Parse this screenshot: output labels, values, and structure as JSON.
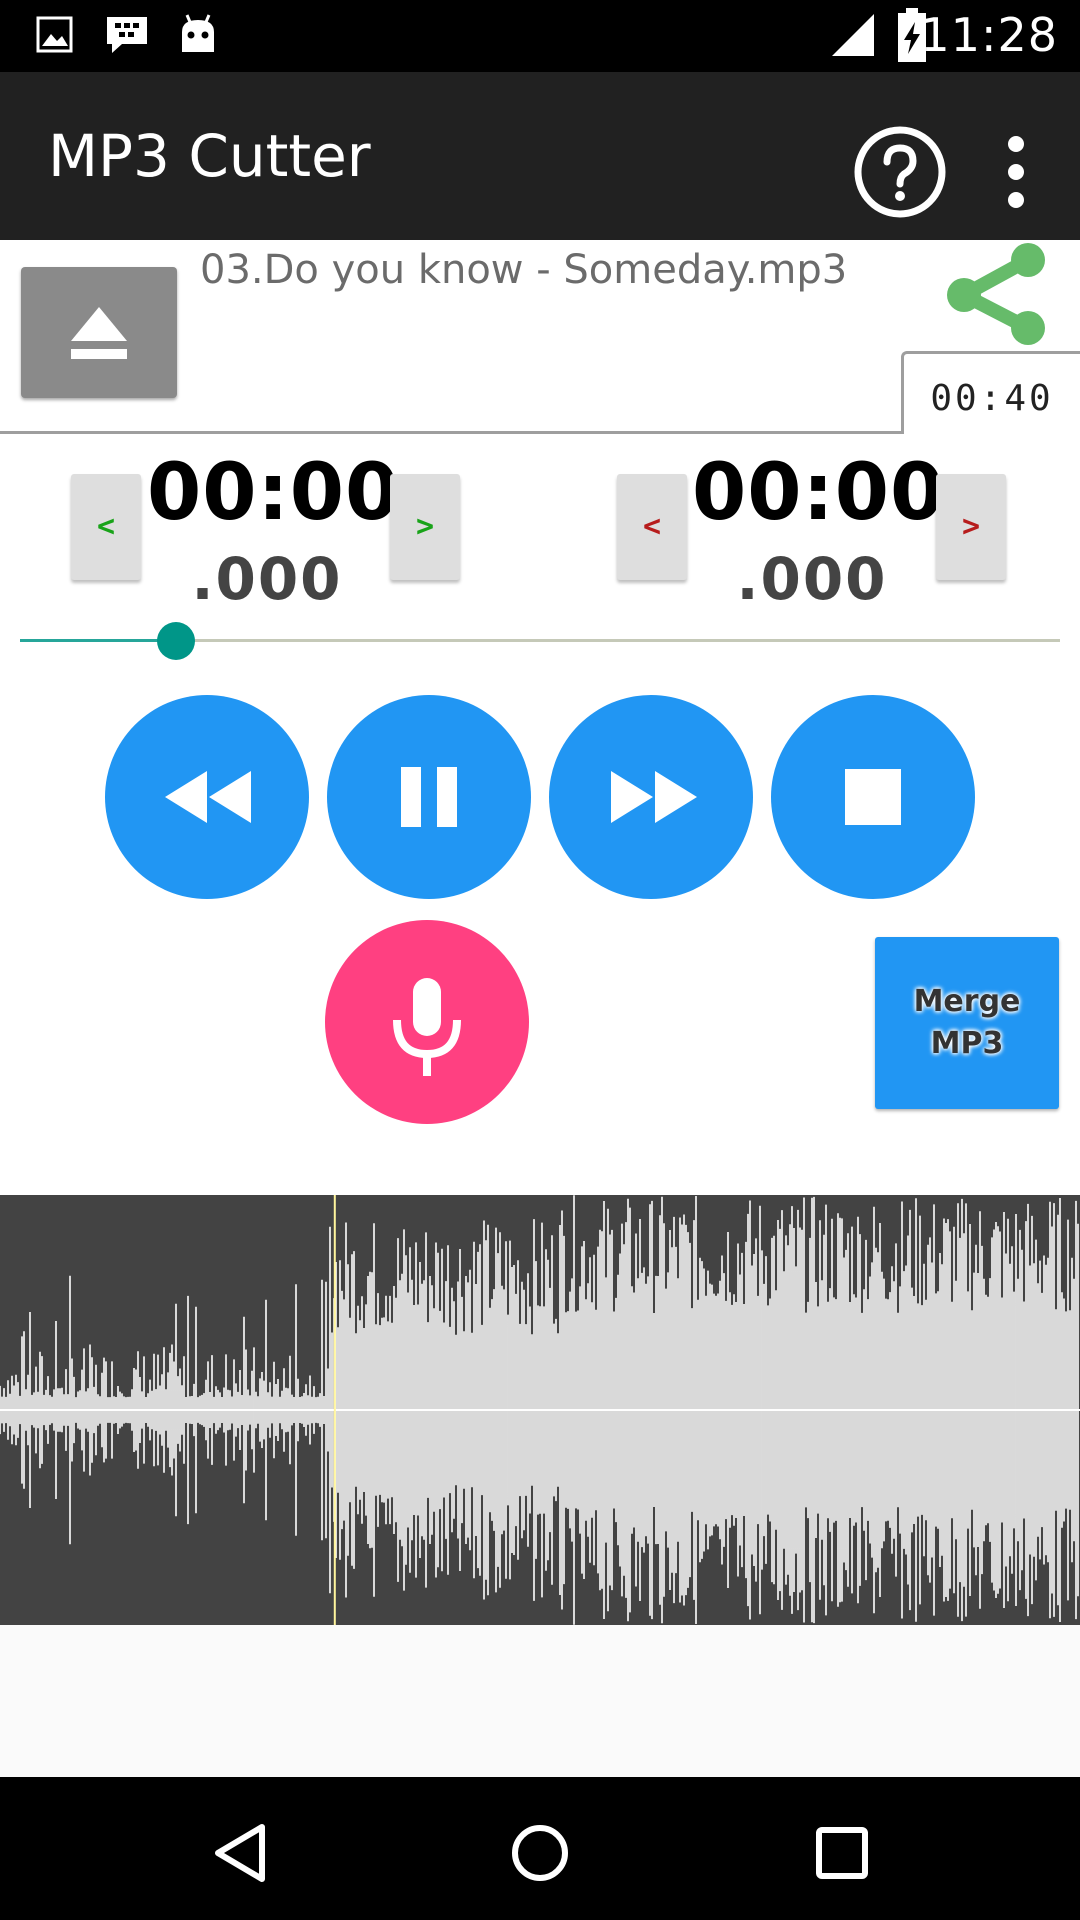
{
  "status_bar": {
    "time": "11:28",
    "icons": [
      "image-icon",
      "blackberry-messenger-icon",
      "android-debug-icon",
      "cellular-signal-icon",
      "battery-charging-icon"
    ]
  },
  "app_bar": {
    "title": "MP3 Cutter",
    "help_icon": "help-circle-icon",
    "overflow_icon": "more-vert-icon"
  },
  "file": {
    "name": "03.Do you know - Someday.mp3",
    "duration": "00:40",
    "eject_icon": "eject-icon",
    "share_icon": "share-icon",
    "share_color": "#4caf50"
  },
  "start_time": {
    "main": "00:00",
    "ms": ".000",
    "decrease_label": "<",
    "increase_label": ">",
    "arrow_color": "#19a319"
  },
  "end_time": {
    "main": "00:00",
    "ms": ".000",
    "decrease_label": "<",
    "increase_label": ">",
    "arrow_color": "#b71c1c"
  },
  "seek": {
    "progress": 0.15
  },
  "player": {
    "buttons": [
      "rewind-icon",
      "pause-icon",
      "fast-forward-icon",
      "stop-icon"
    ],
    "accent": "#2196f3",
    "mic_color": "#ff4081"
  },
  "merge": {
    "line1": "Merge",
    "line2": "MP3"
  },
  "waveform": {
    "playhead_fraction": 0.31,
    "playhead_color": "#fff59d",
    "background": "#434343"
  },
  "nav_bar": {
    "icons": [
      "back-icon",
      "home-icon",
      "recents-icon"
    ]
  }
}
